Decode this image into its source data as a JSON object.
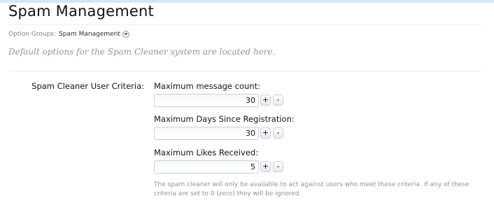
{
  "header": {
    "title": "Spam Management"
  },
  "option_groups": {
    "label": "Option Groups:",
    "value": "Spam Management",
    "icon": "chevron-down-icon"
  },
  "description": "Default options for the Spam Cleaner system are located here.",
  "criteria": {
    "label": "Spam Cleaner User Criteria:",
    "fields": [
      {
        "label": "Maximum message count:",
        "value": "30",
        "plus": "+",
        "minus": "-"
      },
      {
        "label": "Maximum Days Since Registration:",
        "value": "30",
        "plus": "+",
        "minus": "-"
      },
      {
        "label": "Maximum Likes Received:",
        "value": "5",
        "plus": "+",
        "minus": "-"
      }
    ],
    "hint": "The spam cleaner will only be available to act against users who meet these criteria. If any of these criteria are set to 0 (zero) they will be ignored."
  },
  "colors": {
    "accent_bar": "#d7e5f1",
    "muted_text": "#8a97a2",
    "divider": "#e7edf3"
  }
}
